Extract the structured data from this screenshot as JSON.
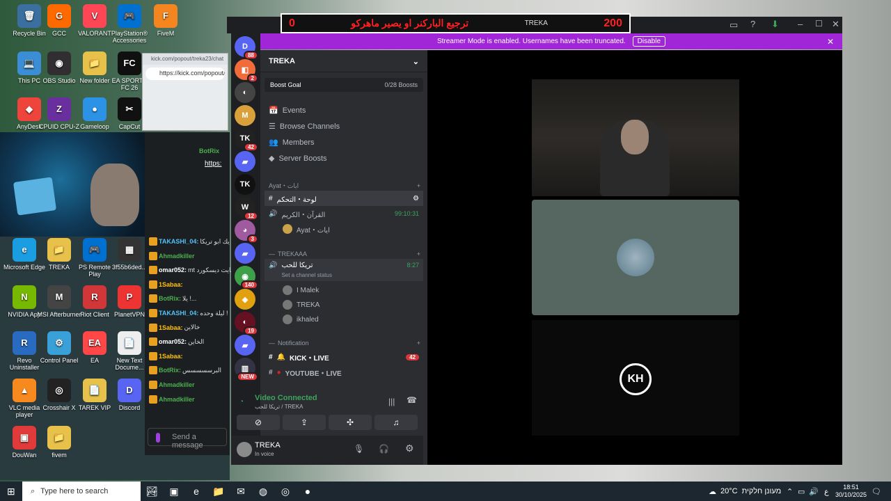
{
  "desktop_icons": [
    {
      "label": "Recycle Bin",
      "glyph": "🗑",
      "bg": "#3b6fa0"
    },
    {
      "label": "GCC",
      "glyph": "G",
      "bg": "#ff6a00"
    },
    {
      "label": "VALORANT",
      "glyph": "V",
      "bg": "#ff4655"
    },
    {
      "label": "PlayStation® Accessories",
      "glyph": "🎮",
      "bg": "#0070d1"
    },
    {
      "label": "FiveM",
      "glyph": "F",
      "bg": "#f5861f"
    },
    {
      "label": "This PC",
      "glyph": "💻",
      "bg": "#3b8ed6"
    },
    {
      "label": "OBS Studio",
      "glyph": "◉",
      "bg": "#302e31"
    },
    {
      "label": "New folder",
      "glyph": "📁",
      "bg": "#e8c14a"
    },
    {
      "label": "EA SPORTS FC 26",
      "glyph": "FC",
      "bg": "#101010"
    },
    {
      "label": "AnyDesk",
      "glyph": "◆",
      "bg": "#ef443b"
    },
    {
      "label": "CPUID CPU-Z",
      "glyph": "Z",
      "bg": "#6a2f9e"
    },
    {
      "label": "Gameloop",
      "glyph": "●",
      "bg": "#2b92e6"
    },
    {
      "label": "CapCut",
      "glyph": "✂",
      "bg": "#111"
    },
    {
      "label": "Microsoft Edge",
      "glyph": "e",
      "bg": "#1b9de2"
    },
    {
      "label": "TREKA",
      "glyph": "📁",
      "bg": "#e8c14a"
    },
    {
      "label": "PS Remote Play",
      "glyph": "🎮",
      "bg": "#0070d1"
    },
    {
      "label": "3f55b6ded...",
      "glyph": "▦",
      "bg": "#333"
    },
    {
      "label": "NVIDIA App",
      "glyph": "N",
      "bg": "#76b900"
    },
    {
      "label": "MSI Afterburner",
      "glyph": "M",
      "bg": "#444"
    },
    {
      "label": "Riot Client",
      "glyph": "R",
      "bg": "#d13639"
    },
    {
      "label": "PlanetVPN",
      "glyph": "P",
      "bg": "#e33"
    },
    {
      "label": "Revo Uninstaller",
      "glyph": "R",
      "bg": "#2a6bc2"
    },
    {
      "label": "Control Panel",
      "glyph": "⚙",
      "bg": "#3aa0d8"
    },
    {
      "label": "EA",
      "glyph": "EA",
      "bg": "#ff4747"
    },
    {
      "label": "New Text Docume...",
      "glyph": "📄",
      "bg": "#eee"
    },
    {
      "label": "VLC media player",
      "glyph": "▲",
      "bg": "#f78a1f"
    },
    {
      "label": "Crosshair X",
      "glyph": "◎",
      "bg": "#222"
    },
    {
      "label": "TAREK VIP",
      "glyph": "📄",
      "bg": "#e8c14a"
    },
    {
      "label": "Discord",
      "glyph": "D",
      "bg": "#5865f2"
    },
    {
      "label": "DouWan",
      "glyph": "▣",
      "bg": "#e03a3a"
    },
    {
      "label": "fivem",
      "glyph": "📁",
      "bg": "#e8c14a"
    }
  ],
  "browser": {
    "tab": "kick.com/popout/treka23/chat",
    "url": "https://kick.com/popout/"
  },
  "chat": {
    "header": "BotRix",
    "link": "https:",
    "lines": [
      {
        "user": "TAKASHI_04:",
        "text": "يك ابو تريكا",
        "color": "#4fc3f7"
      },
      {
        "user": "Ahmadkiller",
        "text": "",
        "color": "#4caf50"
      },
      {
        "user": "omar052:",
        "text": "mt في فايت ديسكورد",
        "color": "#fff"
      },
      {
        "user": "1Sabaa:",
        "text": "",
        "color": "#ffc107"
      },
      {
        "user": "BotRix:",
        "text": "يلا !...",
        "color": "#4caf50"
      },
      {
        "user": "TAKASHI_04:",
        "text": "ليلة وحده !",
        "color": "#4fc3f7"
      },
      {
        "user": "1Sabaa:",
        "text": "خالاين",
        "color": "#ffc107"
      },
      {
        "user": "omar052:",
        "text": "الخاين",
        "color": "#fff"
      },
      {
        "user": "1Sabaa:",
        "text": "",
        "color": "#ffc107"
      },
      {
        "user": "BotRix:",
        "text": "البرسسسسس",
        "color": "#4caf50"
      },
      {
        "user": "Ahmadkiller",
        "text": "",
        "color": "#4caf50"
      },
      {
        "user": "Ahmadkiller",
        "text": "",
        "color": "#4caf50"
      }
    ],
    "send_placeholder": "Send a message"
  },
  "overlay": {
    "left": "0",
    "title": "ترجيع الباركنر او يصير ماهركو",
    "label": "TREKA",
    "right": "200"
  },
  "banner": {
    "text": "Streamer Mode is enabled. Usernames have been truncated.",
    "button": "Disable"
  },
  "servers": [
    {
      "glyph": "D",
      "bg": "#5865f2",
      "count": "88"
    },
    {
      "glyph": "◧",
      "bg": "#f26b3a",
      "count": "2"
    },
    {
      "glyph": "◐",
      "bg": "#444",
      "count": ""
    },
    {
      "glyph": "M",
      "bg": "#d9a13b",
      "count": ""
    },
    {
      "glyph": "TK",
      "bg": "#222",
      "count": "42"
    },
    {
      "glyph": "▰",
      "bg": "#5865f2",
      "count": ""
    },
    {
      "glyph": "TK",
      "bg": "#111",
      "count": ""
    },
    {
      "glyph": "W",
      "bg": "#222",
      "count": "12"
    },
    {
      "glyph": "◕",
      "bg": "#a05a9f",
      "count": "3"
    },
    {
      "glyph": "▰",
      "bg": "#5865f2",
      "count": ""
    },
    {
      "glyph": "◉",
      "bg": "#3fa04a",
      "count": "140"
    },
    {
      "glyph": "◈",
      "bg": "#e0a010",
      "count": ""
    },
    {
      "glyph": "◐",
      "bg": "#612",
      "count": "19"
    },
    {
      "glyph": "▰",
      "bg": "#5865f2",
      "count": ""
    },
    {
      "glyph": "▥",
      "bg": "#334",
      "count": "NEW"
    }
  ],
  "guild": {
    "name": "TREKA",
    "boost_label": "Boost Goal",
    "boost_count": "0/28 Boosts"
  },
  "nav": [
    {
      "label": "Events",
      "icon": "📅"
    },
    {
      "label": "Browse Channels",
      "icon": "☰"
    },
    {
      "label": "Members",
      "icon": "👥"
    },
    {
      "label": "Server Boosts",
      "icon": "◆"
    }
  ],
  "categories": {
    "ayat": "Ayat・ايات",
    "trekaaa": "TREKAAA",
    "notification": "Notification"
  },
  "channels": {
    "control": "لوحة・التحكم",
    "quran": "القرآن・الكريم",
    "quran_time": "99:10:31",
    "quran_user": "Ayat・ايات",
    "voice": "تريكا للحب",
    "voice_time": "8:27",
    "voice_status": "Set a channel status",
    "voice_users": [
      "I Malek",
      "TREKA",
      "ikhaled"
    ],
    "kick": "KICK・LIVE",
    "kick_count": "42",
    "youtube": "YOUTUBE・LIVE"
  },
  "voice_panel": {
    "status": "Video Connected",
    "sub": "تريكا للحب / TREKA"
  },
  "user": {
    "name": "TREKA",
    "status": "In voice"
  },
  "taskbar": {
    "search": "Type here to search",
    "weather": "20°C",
    "weather_text": "מעונן חלקית",
    "lang": "ع",
    "time": "18:51",
    "date": "30/10/2025"
  }
}
